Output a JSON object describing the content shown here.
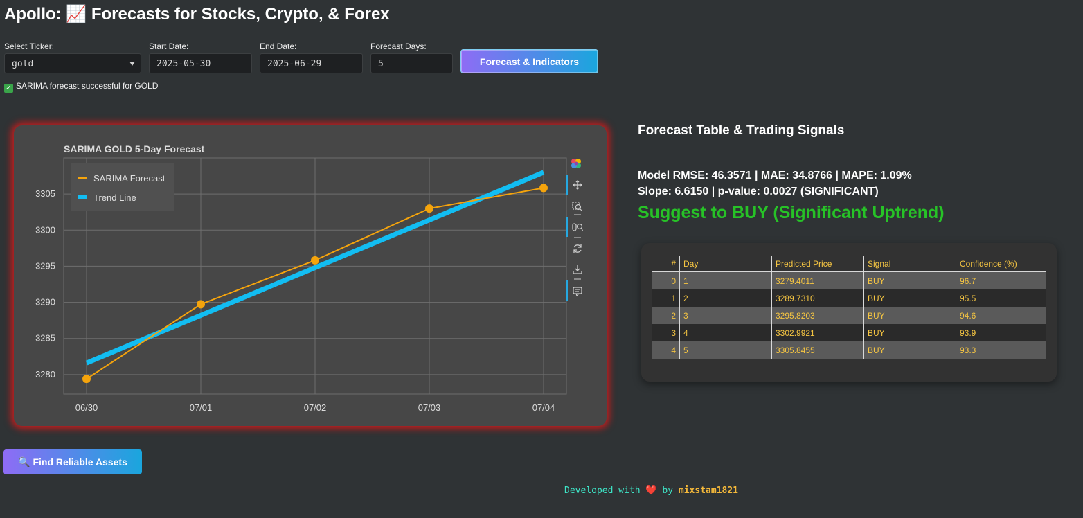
{
  "app": {
    "title": "Apollo: 📈 Forecasts for Stocks, Crypto, & Forex"
  },
  "controls": {
    "ticker_label": "Select Ticker:",
    "ticker_value": "gold",
    "start_label": "Start Date:",
    "start_value": "2025-05-30",
    "end_label": "End Date:",
    "end_value": "2025-06-29",
    "days_label": "Forecast Days:",
    "days_value": "5",
    "forecast_button": "Forecast & Indicators"
  },
  "status": {
    "message": "SARIMA forecast successful for GOLD",
    "icon": "check-icon",
    "color": "#3aa54a"
  },
  "chart_data": {
    "type": "line",
    "title": "SARIMA GOLD 5-Day Forecast",
    "x": [
      "06/30",
      "07/01",
      "07/02",
      "07/03",
      "07/04"
    ],
    "y_ticks": [
      3280,
      3285,
      3290,
      3295,
      3300,
      3305
    ],
    "ylim": [
      3277.3,
      3310.0
    ],
    "grid": true,
    "legend_position": "top-left",
    "series": [
      {
        "name": "SARIMA Forecast",
        "values": [
          3279.4011,
          3289.731,
          3295.8203,
          3302.9921,
          3305.8455
        ],
        "color": "#f5a40c",
        "markers": true
      },
      {
        "name": "Trend Line",
        "values": [
          3281.6,
          3288.2,
          3294.8,
          3301.4,
          3308.0
        ],
        "color": "#12bdf2",
        "markers": false
      }
    ],
    "toolbar": [
      "bokeh-logo-icon",
      "pan-icon",
      "box-zoom-icon",
      "wheel-zoom-icon",
      "reset-icon",
      "save-icon",
      "hover-icon"
    ]
  },
  "panel": {
    "heading": "Forecast Table & Trading Signals",
    "metrics_line": "Model RMSE: 46.3571 | MAE: 34.8766 | MAPE: 1.09%",
    "slope_line": "Slope: 6.6150 | p-value: 0.0027 (SIGNIFICANT)",
    "suggestion": "Suggest to BUY (Significant Uptrend)",
    "suggestion_color": "#27c227"
  },
  "table": {
    "headers": [
      "#",
      "Day",
      "Predicted Price",
      "Signal",
      "Confidence (%)"
    ],
    "rows": [
      [
        "0",
        "1",
        "3279.4011",
        "BUY",
        "96.7"
      ],
      [
        "1",
        "2",
        "3289.7310",
        "BUY",
        "95.5"
      ],
      [
        "2",
        "3",
        "3295.8203",
        "BUY",
        "94.6"
      ],
      [
        "3",
        "4",
        "3302.9921",
        "BUY",
        "93.9"
      ],
      [
        "4",
        "5",
        "3305.8455",
        "BUY",
        "93.3"
      ]
    ]
  },
  "assets_button": "🔍 Find Reliable Assets",
  "footer": {
    "prefix": "Developed with",
    "heart": "❤️",
    "by": "by",
    "author": "mixstam1821"
  }
}
